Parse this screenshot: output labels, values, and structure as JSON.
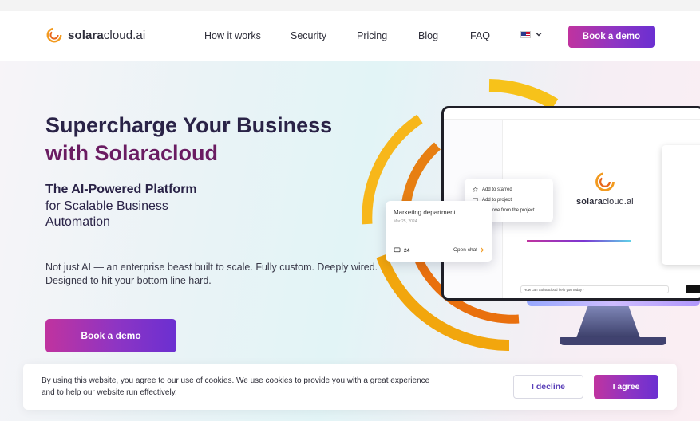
{
  "header": {
    "logo_bold": "solara",
    "logo_rest": "cloud.ai",
    "nav": [
      {
        "label": "How it works"
      },
      {
        "label": "Security"
      },
      {
        "label": "Pricing"
      },
      {
        "label": "Blog"
      },
      {
        "label": "FAQ"
      }
    ],
    "cta_label": "Book a demo"
  },
  "hero": {
    "title_line1": "Supercharge Your Business",
    "title_line2": "with Solaracloud",
    "subtitle_bold": "The AI-Powered Platform",
    "subtitle_line2": "for Scalable Business",
    "subtitle_line3": "Automation",
    "description_line1": "Not just AI — an enterprise beast built to scale. Fully custom. Deeply wired.",
    "description_line2": "Designed to hit your bottom line hard.",
    "cta_label": "Book a demo"
  },
  "mockup": {
    "menu_items": [
      {
        "label": "Add to starred"
      },
      {
        "label": "Add to project"
      },
      {
        "label": "Remove from the project"
      }
    ],
    "card": {
      "title": "Marketing department",
      "date": "Mar 25, 2024",
      "count": "24",
      "open_label": "Open chat"
    },
    "chat_placeholder": "How can Solaracloud help you today?",
    "logo_bold": "solara",
    "logo_rest": "cloud.ai"
  },
  "cookie": {
    "text_line1": "By using this website, you agree to our use of cookies. We use cookies to provide you with a great experience",
    "text_line2": "and to help our website run effectively.",
    "decline_label": "I decline",
    "agree_label": "I agree"
  },
  "colors": {
    "accent_start": "#c0339f",
    "accent_end": "#6b2fd1",
    "title_accent": "#6a1c62",
    "arc_orange": "#f0a000"
  }
}
